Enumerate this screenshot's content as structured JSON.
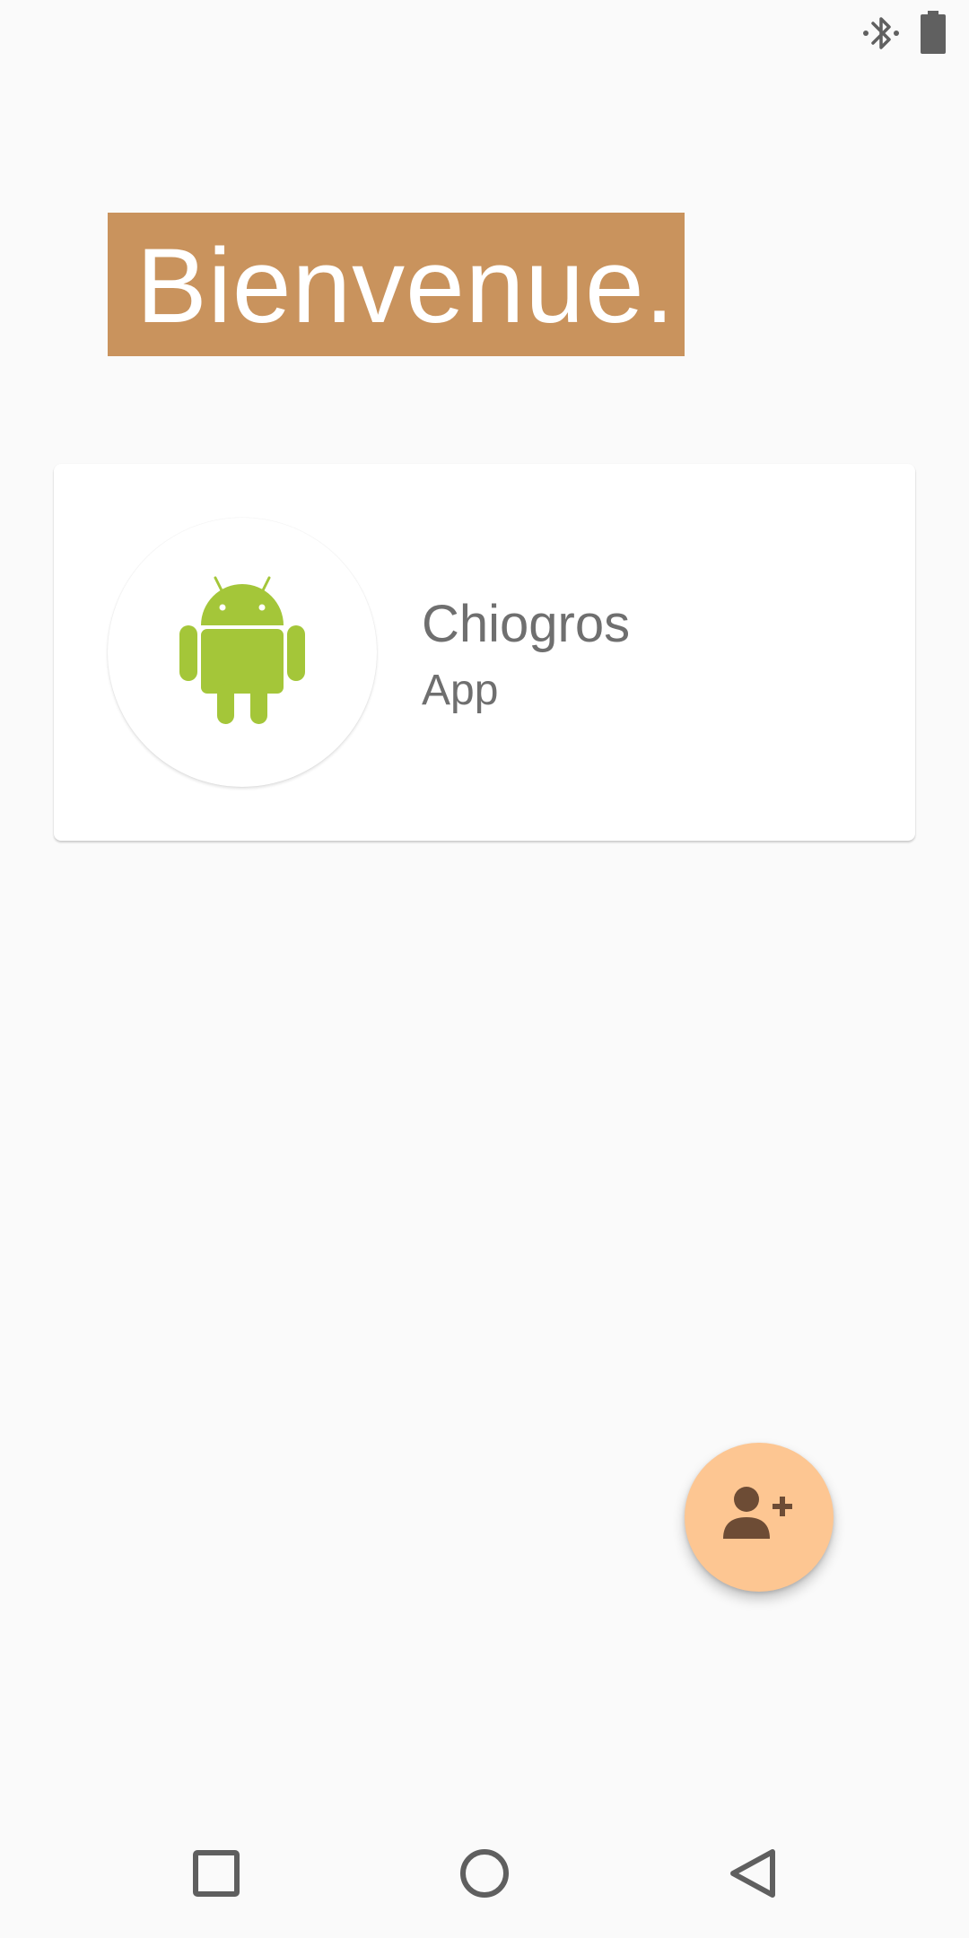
{
  "status_bar": {
    "icons": [
      "bluetooth-icon",
      "battery-icon"
    ]
  },
  "welcome": {
    "title": "Bienvenue.",
    "background_color": "#c9935d"
  },
  "app_card": {
    "icon": "android-icon",
    "name": "Chiogros",
    "type": "App"
  },
  "fab": {
    "icon": "person-add-icon",
    "color": "#fdc692"
  },
  "nav_bar": {
    "buttons": [
      "recents-icon",
      "home-icon",
      "back-icon"
    ]
  }
}
